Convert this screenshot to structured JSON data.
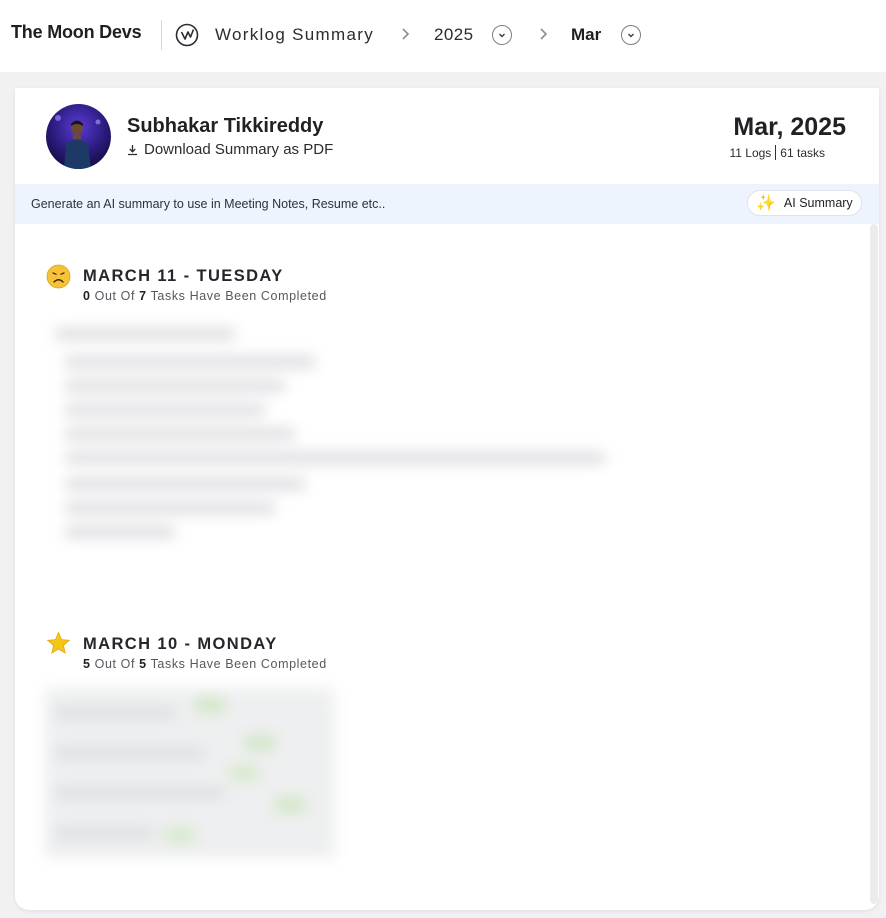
{
  "topbar": {
    "brand": "The Moon Devs",
    "breadcrumb_title": "Worklog Summary",
    "year": "2025",
    "month": "Mar"
  },
  "profile": {
    "name": "Subhakar Tikkireddy",
    "download_label": "Download Summary as PDF",
    "period": "Mar, 2025",
    "logs": "11 Logs",
    "tasks": "61 tasks"
  },
  "ai_bar": {
    "text": "Generate an AI summary to use in Meeting Notes, Resume etc..",
    "button_label": "AI Summary"
  },
  "days": [
    {
      "title": "MARCH 11 - TUESDAY",
      "completed": "0",
      "out_of_label": "Out Of",
      "total": "7",
      "suffix": "Tasks Have Been Completed",
      "mood_icon": "frowning-face-icon"
    },
    {
      "title": "MARCH 10 - MONDAY",
      "completed": "5",
      "out_of_label": "Out Of",
      "total": "5",
      "suffix": "Tasks Have Been Completed",
      "mood_icon": "star-icon"
    }
  ],
  "colors": {
    "accent_ai_bar": "#eef4fd",
    "sparkle": "#e9b93a",
    "star": "#f5c518",
    "frown": "#f2b932"
  }
}
